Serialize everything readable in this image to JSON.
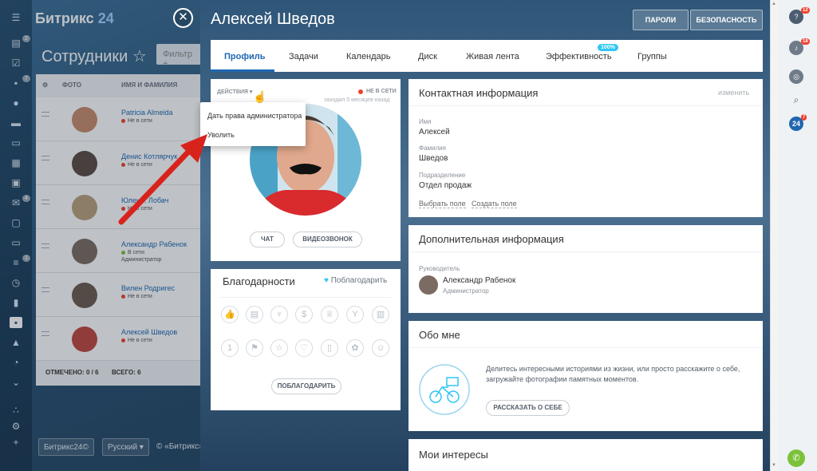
{
  "app": {
    "logo_main": "Битрикс",
    "logo_num": "24",
    "page_title": "Сотрудники",
    "star": "☆",
    "filter": "Фильтр +"
  },
  "table": {
    "headers": {
      "photo": "ФОТО",
      "name": "ИМЯ И ФАМИЛИЯ"
    },
    "rows": [
      {
        "name": "Patricia Almeida",
        "status": "Не в сети",
        "dot": "#f0412f",
        "role": "",
        "avatar": "#c98a6c"
      },
      {
        "name": "Денис Котлярчук",
        "status": "Не в сети",
        "dot": "#f0412f",
        "role": "",
        "avatar": "#5c4a44"
      },
      {
        "name": "Юлен... Лобач",
        "status": "Не в сети",
        "dot": "#f0412f",
        "role": "",
        "avatar": "#b9a07a"
      },
      {
        "name": "Александр Рабенок",
        "status": "В сети",
        "dot": "#7bc23a",
        "role": "Администратор",
        "avatar": "#7c6b62"
      },
      {
        "name": "Вилен Родригес",
        "status": "Не в сети",
        "dot": "#f0412f",
        "role": "",
        "avatar": "#6d5a50"
      },
      {
        "name": "Алексей Шведов",
        "status": "Не в сети",
        "dot": "#f0412f",
        "role": "",
        "avatar": "#c0463d"
      }
    ],
    "footer_checked": "ОТМЕЧЕНО: 0 / 6",
    "footer_total": "ВСЕГО: 6"
  },
  "footer": {
    "brand": "Битрикс24©",
    "lang": "Русский",
    "copy": "© «Битрикс»,"
  },
  "profile": {
    "title": "Алексей Шведов",
    "btn_passwords": "ПАРОЛИ",
    "btn_security": "БЕЗОПАСНОСТЬ",
    "tabs": [
      "Профиль",
      "Задачи",
      "Календарь",
      "Диск",
      "Живая лента",
      "Эффективность",
      "Группы"
    ],
    "eff_badge": "100%",
    "actions": "ДЕЙСТВИЯ",
    "offline": "НЕ В СЕТИ",
    "last_seen": "заходил 5 месяцев назад",
    "btn_chat": "ЧАТ",
    "btn_video": "ВИДЕОЗВОНОК",
    "menu": [
      "Дать права администратора",
      "Уволить"
    ],
    "thanks_title": "Благодарности",
    "thanks_link": "Поблагодарить",
    "thanks_btn": "ПОБЛАГОДАРИТЬ",
    "contact": {
      "title": "Контактная информация",
      "edit": "изменить",
      "fields": [
        {
          "label": "Имя",
          "value": "Алексей"
        },
        {
          "label": "Фамилия",
          "value": "Шведов"
        },
        {
          "label": "Подразделение",
          "value": "Отдел продаж"
        }
      ],
      "link_select": "Выбрать поле",
      "link_create": "Создать поле"
    },
    "extra": {
      "title": "Дополнительная информация",
      "manager_label": "Руководитель",
      "manager_name": "Александр Рабенок",
      "manager_role": "Администратор"
    },
    "about": {
      "title": "Обо мне",
      "text": "Делитесь интересными историями из жизни, или просто расскажите о себе, загружайте фотографии памятных моментов.",
      "btn": "РАССКАЗАТЬ О СЕБЕ"
    },
    "interests": {
      "title": "Мои интересы"
    }
  },
  "rightbar": {
    "badges": [
      "12",
      "18",
      "7"
    ],
    "b24": "24"
  },
  "colors": {
    "accent": "#2067b0",
    "offline": "#f0412f",
    "online": "#7bc23a",
    "badge": "#2fc6f6"
  }
}
